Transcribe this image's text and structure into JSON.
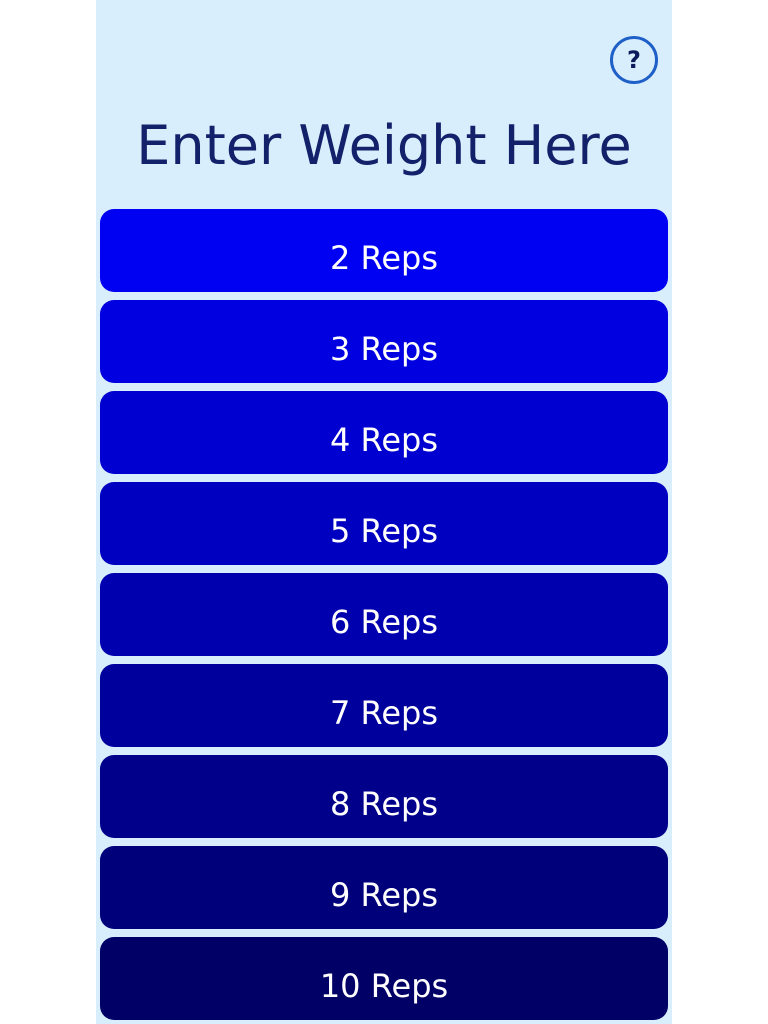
{
  "help": {
    "label": "?"
  },
  "title": "Enter Weight Here",
  "reps": [
    {
      "label": "2 Reps",
      "color": "#0000f2"
    },
    {
      "label": "3 Reps",
      "color": "#0000e0"
    },
    {
      "label": "4 Reps",
      "color": "#0000d0"
    },
    {
      "label": "5 Reps",
      "color": "#0000c0"
    },
    {
      "label": "6 Reps",
      "color": "#0000ae"
    },
    {
      "label": "7 Reps",
      "color": "#00009c"
    },
    {
      "label": "8 Reps",
      "color": "#00008a"
    },
    {
      "label": "9 Reps",
      "color": "#00007a"
    },
    {
      "label": "10 Reps",
      "color": "#000066"
    }
  ]
}
